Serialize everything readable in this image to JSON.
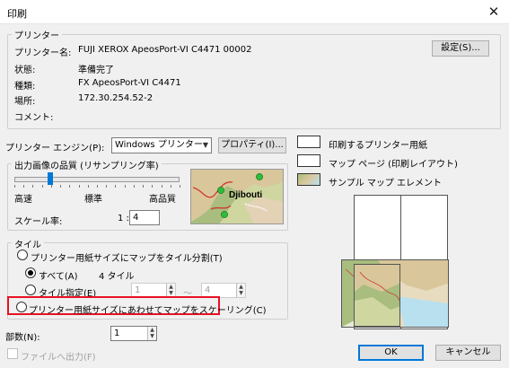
{
  "window": {
    "title": "印刷",
    "close_icon": "close-icon"
  },
  "printer": {
    "group_label": "プリンター",
    "name_label": "プリンター名:",
    "name_value": "FUJI XEROX ApeosPort-VI C4471 00002",
    "status_label": "状態:",
    "status_value": "準備完了",
    "type_label": "種類:",
    "type_value": "FX ApeosPort-VI C4471",
    "location_label": "場所:",
    "location_value": "172.30.254.52-2",
    "comment_label": "コメント:",
    "settings_button": "設定(S)..."
  },
  "engine": {
    "label": "プリンター エンジン(P):",
    "selected": "Windows プリンター",
    "properties_button": "プロパティ(I)..."
  },
  "quality": {
    "group_label": "出力画像の品質 (リサンプリング率)",
    "low": "高速",
    "mid": "標準",
    "high": "高品質",
    "slider_level": 0.22,
    "scale_label": "スケール率:",
    "scale_prefix": "1 :",
    "scale_value": "4",
    "preview_label": "Djibouti"
  },
  "tile": {
    "group_label": "タイル",
    "option_tile_label": "プリンター用紙サイズにマップをタイル分割(T)",
    "all_label": "すべて(A)",
    "all_count": "4 タイル",
    "range_label": "タイル指定(E)",
    "range_from": "1",
    "range_sep": "～",
    "range_to": "4",
    "option_scale_label": "プリンター用紙サイズにあわせてマップをスケーリング(C)"
  },
  "copies": {
    "label": "部数(N):",
    "value": "1"
  },
  "print_to_file": {
    "label": "ファイルへ出力(F)"
  },
  "legend": {
    "paper": "印刷するプリンター用紙",
    "map_page": "マップ ページ (印刷レイアウト)",
    "sample": "サンプル マップ エレメント"
  },
  "buttons": {
    "ok": "OK",
    "cancel": "キャンセル"
  },
  "colors": {
    "accent": "#0078d7",
    "highlight": "#e81123"
  }
}
